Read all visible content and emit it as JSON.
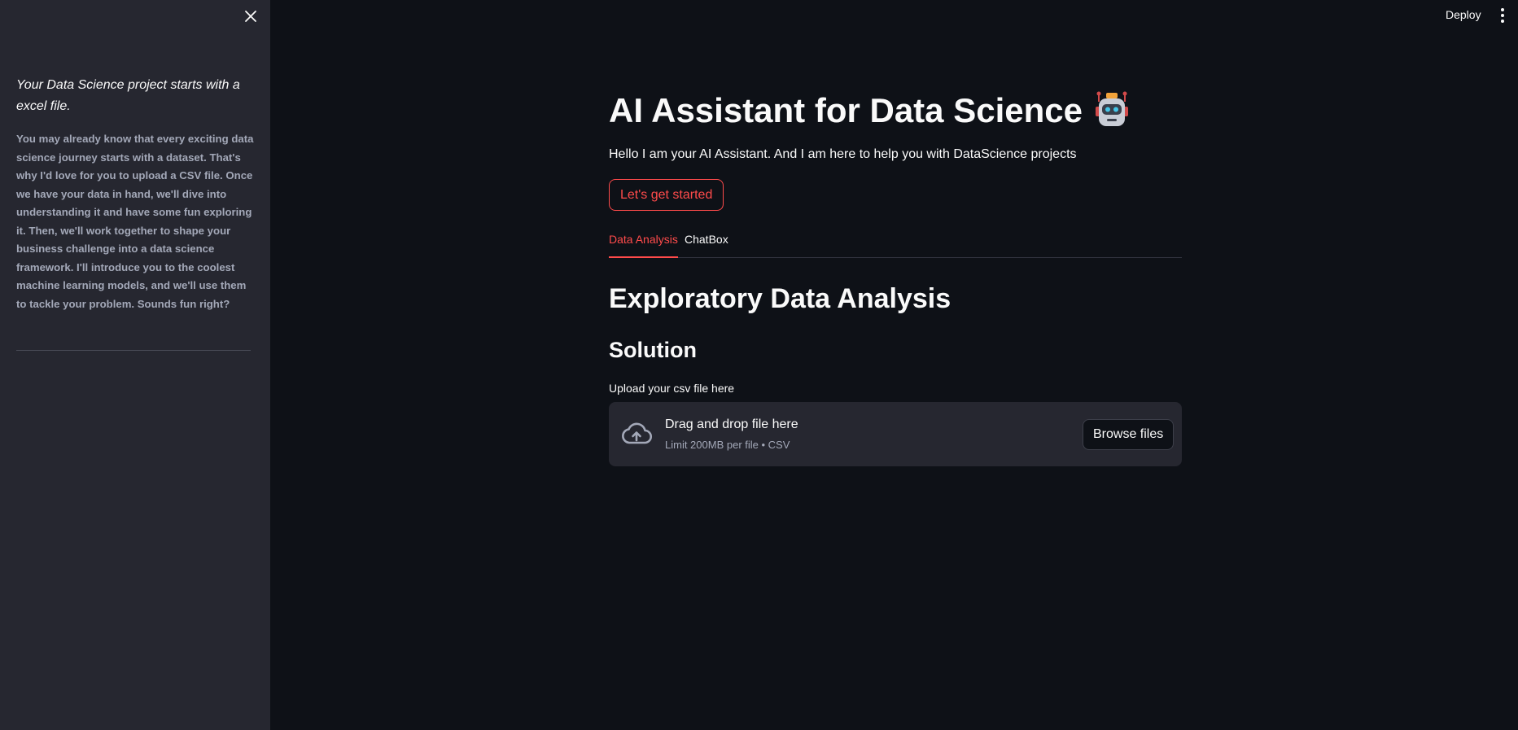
{
  "sidebar": {
    "title": "Your Data Science project starts with a excel file.",
    "body": "You may already know that every exciting data science journey starts with a dataset. That's why I'd love for you to upload a CSV file. Once we have your data in hand, we'll dive into understanding it and have some fun exploring it. Then, we'll work together to shape your business challenge into a data science framework. I'll introduce you to the coolest machine learning models, and we'll use them to tackle your problem. Sounds fun right?",
    "close_icon": "close-icon"
  },
  "topbar": {
    "deploy_label": "Deploy",
    "menu_icon": "more-vertical-icon"
  },
  "main": {
    "title": "AI Assistant for Data Science",
    "title_icon": "robot-icon",
    "intro": "Hello I am your AI Assistant. And I am here to help you with DataScience projects",
    "start_button_label": "Let's get started",
    "tabs": [
      {
        "label": "Data Analysis",
        "active": true
      },
      {
        "label": "ChatBox",
        "active": false
      }
    ],
    "section_title": "Exploratory Data Analysis",
    "subsection_title": "Solution",
    "uploader": {
      "label": "Upload your csv file here",
      "drop_title": "Drag and drop file here",
      "limit_text": "Limit 200MB per file • CSV",
      "browse_label": "Browse files",
      "icon": "cloud-upload-icon"
    }
  },
  "colors": {
    "background": "#0e1117",
    "sidebar": "#262730",
    "accent": "#ff4b4b",
    "text": "#fafafa",
    "muted": "#a3a8b8"
  }
}
